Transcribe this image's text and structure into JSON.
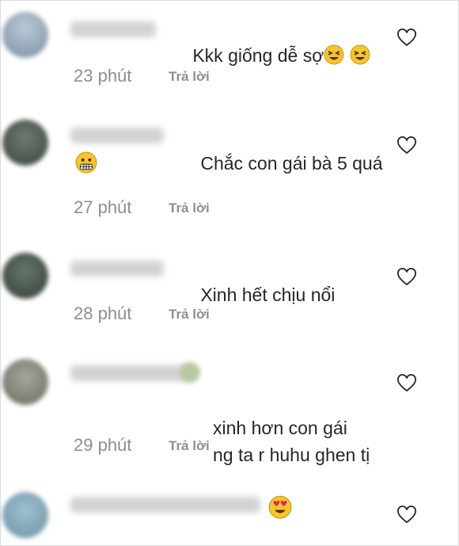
{
  "comments": [
    {
      "text": "Kkk giống dễ sợ",
      "emojis": [
        "laughing-face-icon",
        "laughing-face-icon"
      ],
      "time": "23 phút",
      "reply": "Trả lời"
    },
    {
      "text": "Chắc con gái bà 5 quá",
      "emojis": [
        "grimacing-face-icon"
      ],
      "time": "27 phút",
      "reply": "Trả lời"
    },
    {
      "text": "Xinh hết chịu nổi",
      "emojis": [],
      "time": "28 phút",
      "reply": "Trả lời"
    },
    {
      "text": "xinh hơn con gái\nng ta r huhu ghen tị",
      "emojis": [],
      "time": "29 phút",
      "reply": "Trả lời"
    },
    {
      "text": "",
      "emojis": [
        "heart-eyes-face-icon"
      ],
      "time": "",
      "reply": ""
    }
  ],
  "colors": {
    "text": "#262626",
    "muted": "#8e8e8e",
    "border": "#dbdbdb",
    "emoji_yellow": "#f7c52b"
  }
}
